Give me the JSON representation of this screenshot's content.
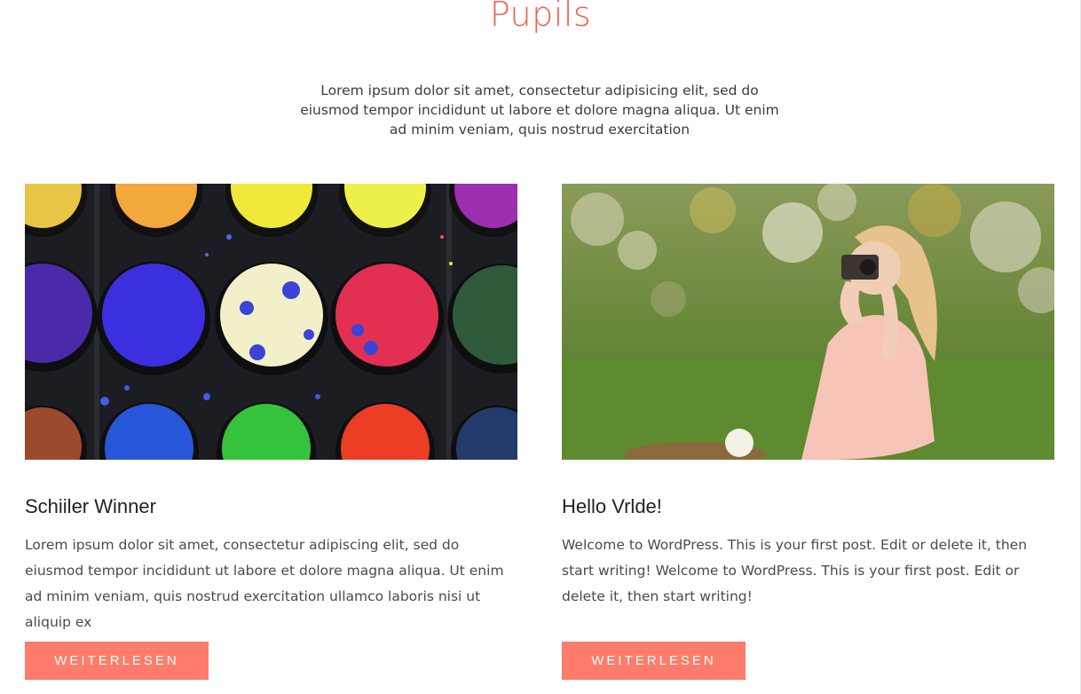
{
  "colors": {
    "accent": "#ff7b6b",
    "title": "#f0624d"
  },
  "section": {
    "title": "Pupils",
    "intro": "Lorem ipsum dolor sit amet, consectetur adipisicing elit, sed do eiusmod tempor incididunt ut labore et dolore magna aliqua. Ut enim ad minim veniam, quis nostrud exercitation"
  },
  "cards": [
    {
      "image": "watercolor-paint-palette-image",
      "title": "Schiiler Winner",
      "text": "Lorem ipsum dolor sit amet, consectetur adipiscing elit, sed do eiusmod tempor incididunt ut labore et dolore magna aliqua. Ut enim ad minim veniam, quis nostrud exercitation ullamco laboris nisi ut aliquip ex",
      "button": "WEITERLESEN"
    },
    {
      "image": "girl-with-camera-in-meadow-image",
      "title": "Hello Vrlde!",
      "text": "Welcome to WordPress. This is your first post. Edit or delete it, then start writing! Welcome to WordPress. This is your first post. Edit or delete it, then start writing!",
      "button": "WEITERLESEN"
    }
  ]
}
